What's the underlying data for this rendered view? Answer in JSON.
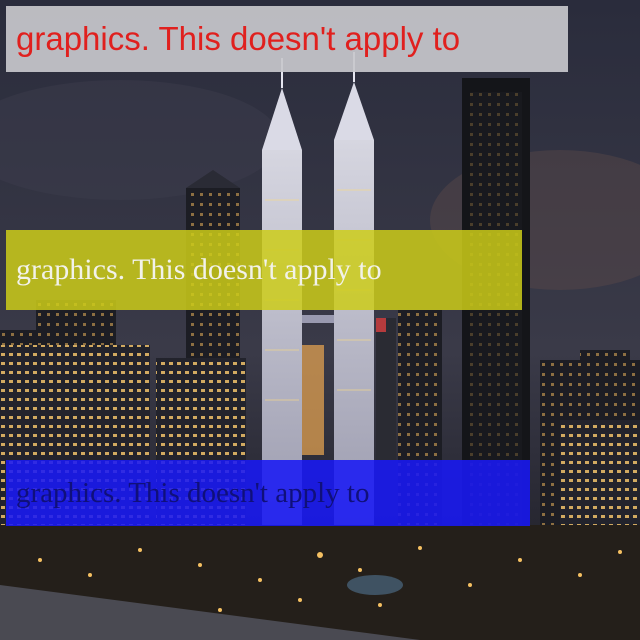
{
  "captions": {
    "top": {
      "text": "graphics. This doesn't apply to",
      "color": "#e0201e",
      "background": "#c8c8cc"
    },
    "middle": {
      "text": "graphics. This doesn't apply to",
      "color": "#f2f2ea",
      "background": "#cdcd19"
    },
    "bottom": {
      "text": "graphics. This doesn't apply to",
      "color": "#10107a",
      "background": "#1919f5"
    }
  },
  "photo": {
    "subject": "night-city-skyline-with-twin-towers",
    "sky_color": "#262838",
    "light_color": "#f5c062"
  }
}
